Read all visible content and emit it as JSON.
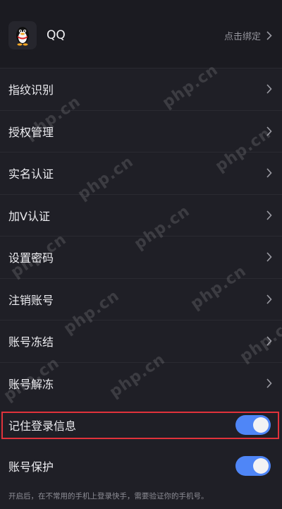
{
  "account": {
    "name": "QQ",
    "action_label": "点击绑定",
    "icon": "penguin-icon"
  },
  "menu_items": [
    {
      "label": "指纹识别"
    },
    {
      "label": "授权管理"
    },
    {
      "label": "实名认证"
    },
    {
      "label": "加V认证"
    },
    {
      "label": "设置密码"
    },
    {
      "label": "注销账号"
    },
    {
      "label": "账号冻结"
    },
    {
      "label": "账号解冻"
    }
  ],
  "toggles": [
    {
      "label": "记住登录信息",
      "on": true,
      "highlighted": true
    },
    {
      "label": "账号保护",
      "on": true,
      "highlighted": false
    }
  ],
  "hint": "开启后，在不常用的手机上登录快手，需要验证你的手机号。",
  "watermark_text": "php.cn",
  "colors": {
    "background": "#1f1f26",
    "toggle_on": "#4f86f7",
    "highlight": "#e0323b"
  }
}
